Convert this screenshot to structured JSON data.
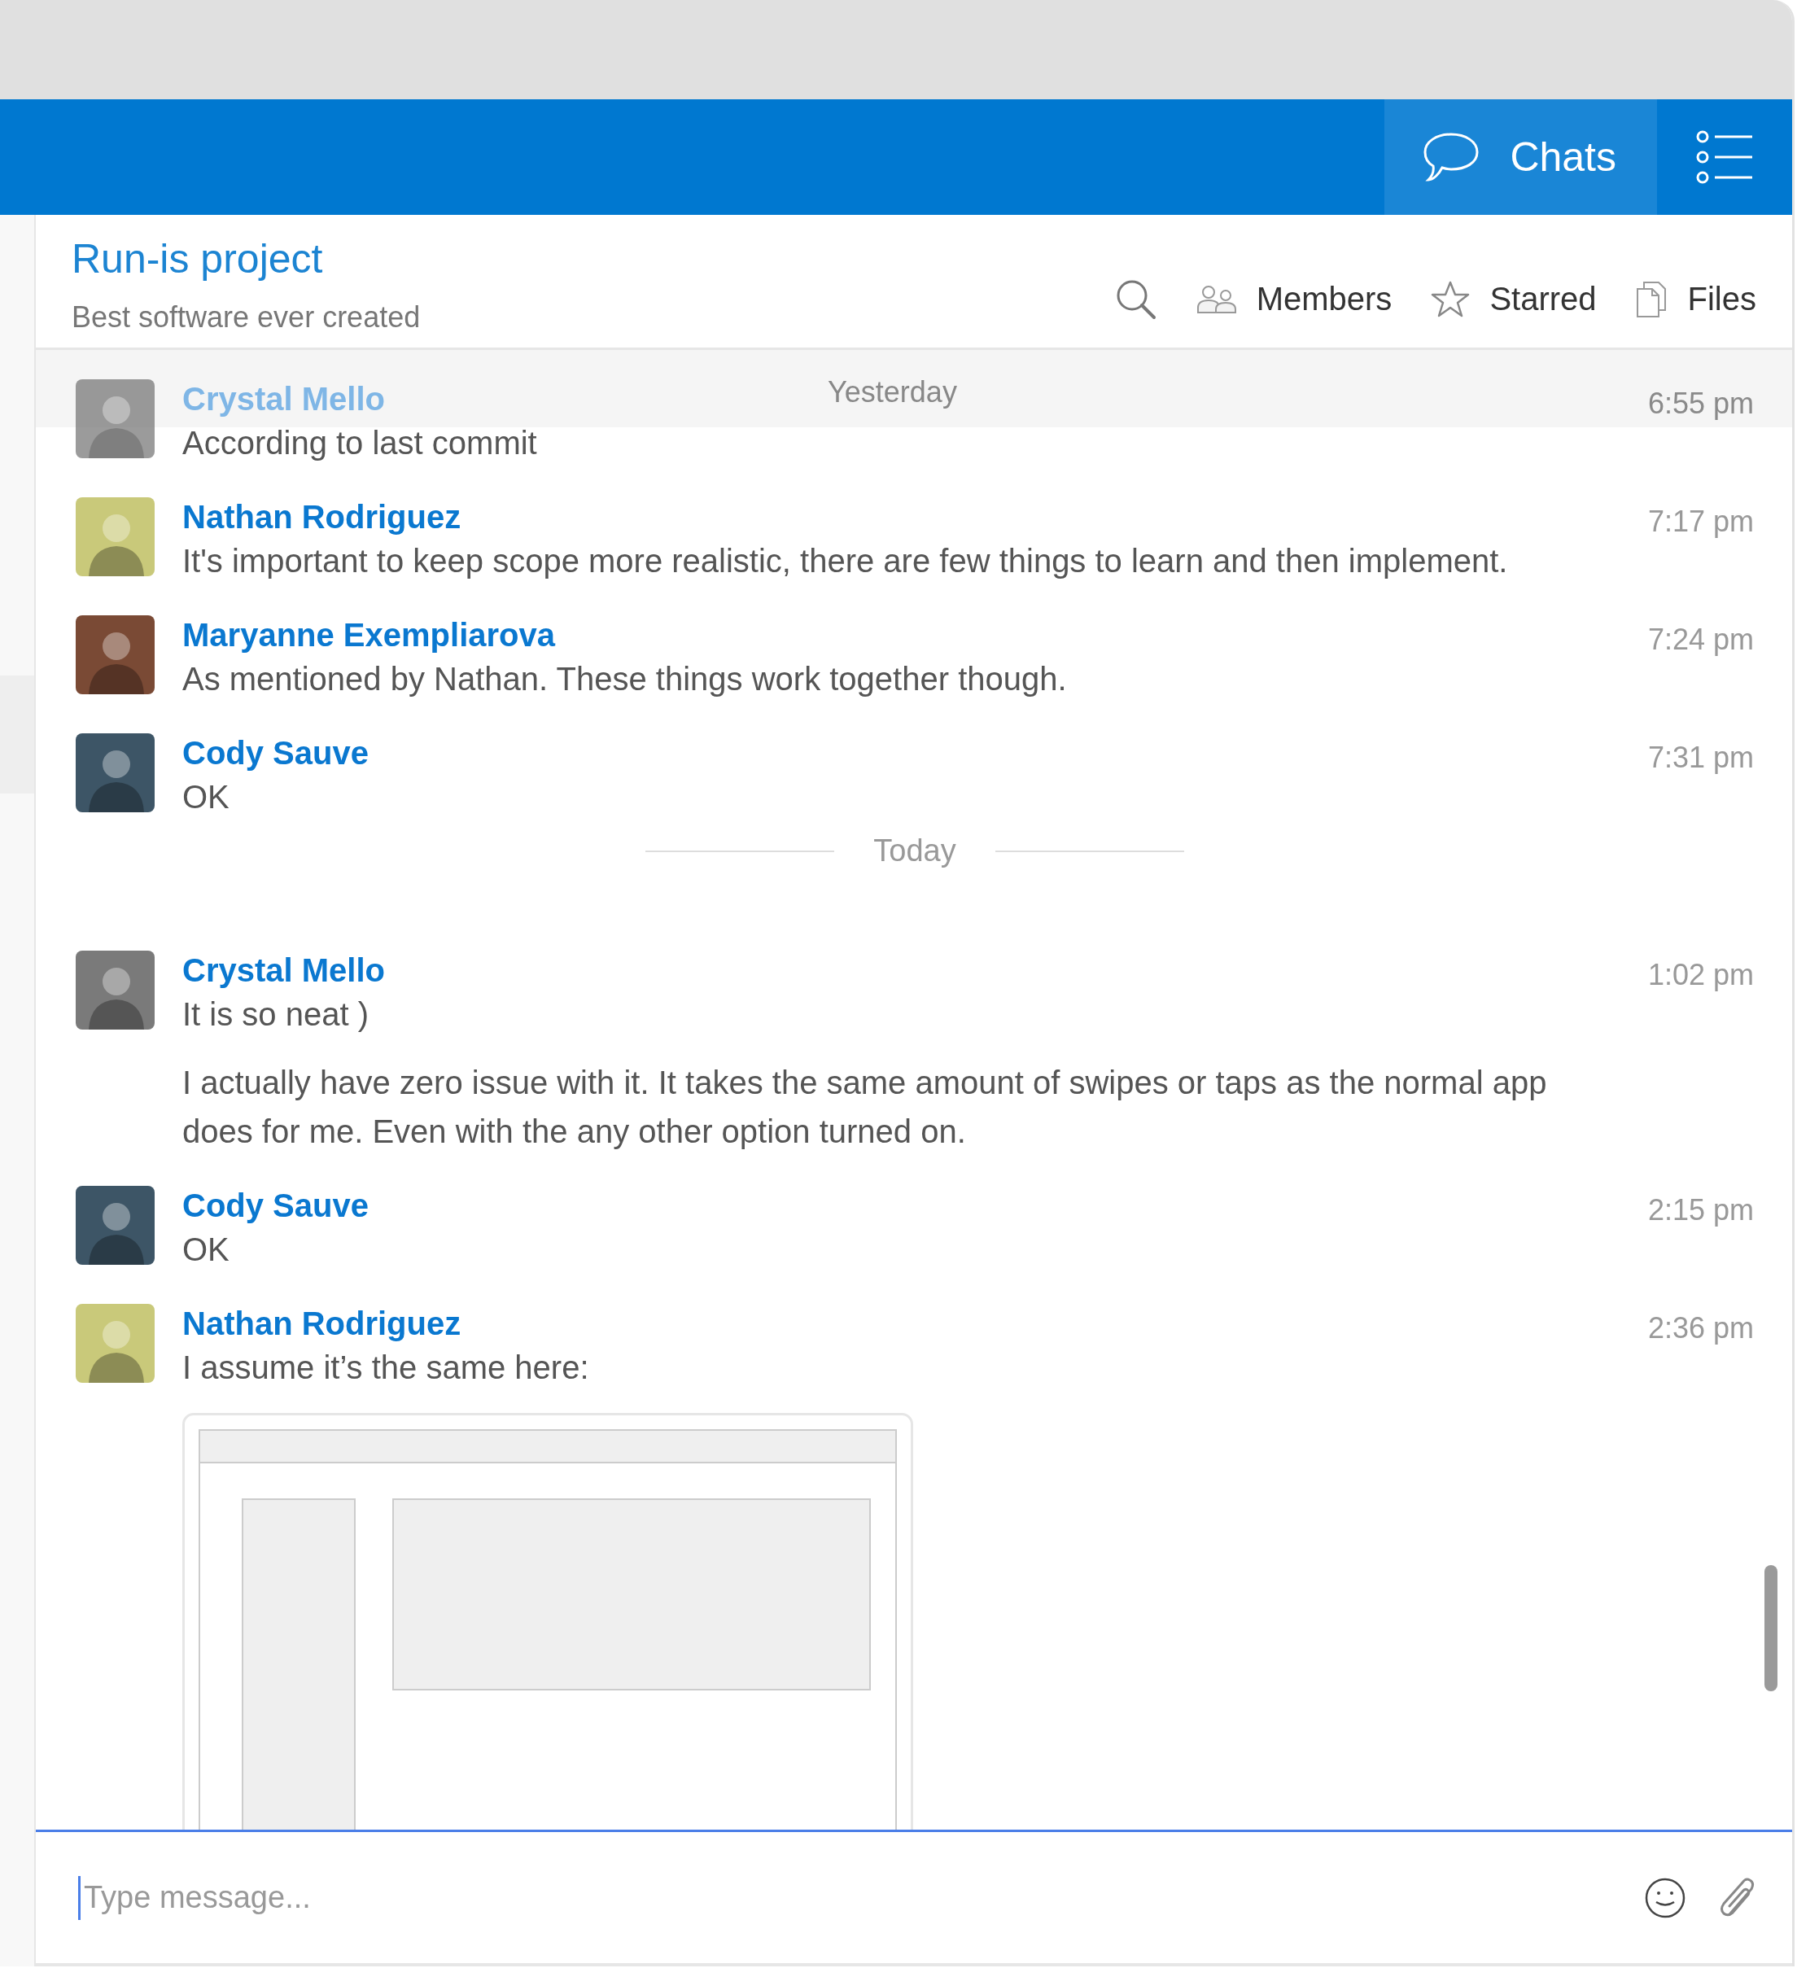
{
  "header": {
    "tabs": [
      {
        "label": "Chats",
        "selected": true
      }
    ]
  },
  "chat": {
    "title": "Run-is project",
    "subtitle": "Best software ever created",
    "actions": [
      {
        "kind": "search"
      },
      {
        "kind": "members",
        "label": "Members"
      },
      {
        "kind": "starred",
        "label": "Starred"
      },
      {
        "kind": "files",
        "label": "Files"
      }
    ]
  },
  "day_header": {
    "label": "Yesterday"
  },
  "messages": [
    {
      "kind": "message",
      "author": "Crystal Mello",
      "time": "6:55 pm",
      "dimmed": true,
      "avatar": {
        "color": "#7a7a7a"
      },
      "paragraphs": [
        "According to last commit"
      ]
    },
    {
      "kind": "message",
      "author": "Nathan Rodriguez",
      "time": "7:17 pm",
      "dimmed": false,
      "avatar": {
        "color": "#c9c97a"
      },
      "paragraphs": [
        "It's important to keep scope more realistic, there are few things to learn and then implement."
      ]
    },
    {
      "kind": "message",
      "author": "Maryanne Exempliarova",
      "time": "7:24 pm",
      "dimmed": false,
      "avatar": {
        "color": "#7a4a35"
      },
      "paragraphs": [
        "As mentioned by Nathan. These things work together though."
      ]
    },
    {
      "kind": "message",
      "author": "Cody Sauve",
      "time": "7:31 pm",
      "dimmed": false,
      "avatar": {
        "color": "#3d5566"
      },
      "paragraphs": [
        "OK"
      ]
    },
    {
      "kind": "separator",
      "label": "Today"
    },
    {
      "kind": "message",
      "author": "Crystal Mello",
      "time": "1:02 pm",
      "dimmed": false,
      "avatar": {
        "color": "#7a7a7a"
      },
      "paragraphs": [
        "It is so neat )",
        "I actually have zero issue with it. It takes the same amount of swipes or taps as the normal app does for me. Even with the any other option turned on."
      ]
    },
    {
      "kind": "message",
      "author": "Cody Sauve",
      "time": "2:15 pm",
      "dimmed": false,
      "avatar": {
        "color": "#3d5566"
      },
      "paragraphs": [
        "OK"
      ]
    },
    {
      "kind": "message",
      "author": "Nathan Rodriguez",
      "time": "2:36 pm",
      "dimmed": false,
      "avatar": {
        "color": "#c9c97a"
      },
      "paragraphs": [
        "I assume it’s the same here:"
      ],
      "attachment": {
        "kind": "picture"
      }
    }
  ],
  "composer": {
    "placeholder": "Type message..."
  }
}
